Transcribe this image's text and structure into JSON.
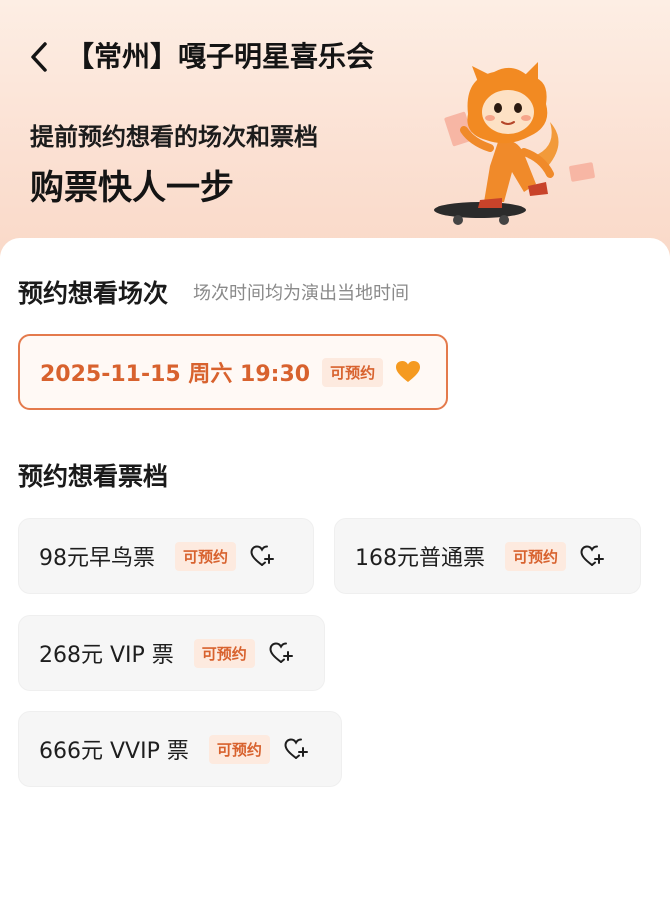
{
  "header": {
    "title": "【常州】嘎子明星喜乐会",
    "back_icon": "chevron-left-icon"
  },
  "hero": {
    "line1": "提前预约想看的场次和票档",
    "line2": "购票快人一步",
    "mascot": "skateboarding-fox-mascot"
  },
  "session_section": {
    "title": "预约想看场次",
    "note": "场次时间均为演出当地时间",
    "sessions": [
      {
        "date": "2025-11-15 周六 19:30",
        "status": "可预约",
        "selected": true,
        "icon": "heart-filled-icon"
      }
    ]
  },
  "ticket_section": {
    "title": "预约想看票档",
    "tiers": [
      {
        "label": "98元早鸟票",
        "status": "可预约",
        "icon": "heart-plus-icon"
      },
      {
        "label": "168元普通票",
        "status": "可预约",
        "icon": "heart-plus-icon"
      },
      {
        "label": "268元 VIP 票",
        "status": "可预约",
        "icon": "heart-plus-icon"
      },
      {
        "label": "666元 VVIP 票",
        "status": "可预约",
        "icon": "heart-plus-icon"
      }
    ]
  },
  "colors": {
    "accent": "#e47a4c",
    "accent_text": "#d8622e",
    "tag_bg": "#fdeadf",
    "hero_bg": "#fbe0d2",
    "tier_bg": "#f6f6f6"
  }
}
